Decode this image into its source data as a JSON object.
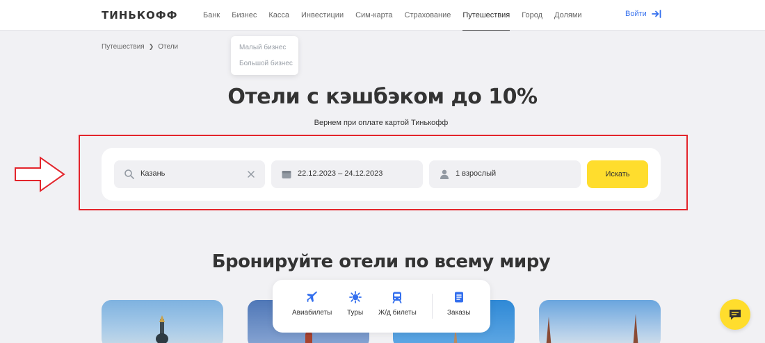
{
  "header": {
    "logo": "ТИНЬКОФФ",
    "nav": [
      {
        "label": "Банк"
      },
      {
        "label": "Бизнес"
      },
      {
        "label": "Касса"
      },
      {
        "label": "Инвестиции"
      },
      {
        "label": "Сим-карта"
      },
      {
        "label": "Страхование"
      },
      {
        "label": "Путешествия",
        "active": true
      },
      {
        "label": "Город"
      },
      {
        "label": "Долями"
      }
    ],
    "login_label": "Войти"
  },
  "dropdown": {
    "items": [
      "Малый бизнес",
      "Большой бизнес"
    ]
  },
  "breadcrumb": {
    "items": [
      "Путешествия",
      "Отели"
    ]
  },
  "hero": {
    "title": "Отели с кэшбэком до 10%",
    "subtitle": "Вернем при оплате картой Тинькофф"
  },
  "search": {
    "destination": "Казань",
    "dates": "22.12.2023 – 24.12.2023",
    "guests": "1 взрослый",
    "submit_label": "Искать"
  },
  "section": {
    "title": "Бронируйте отели по всему миру"
  },
  "tabs": [
    {
      "label": "Авиабилеты",
      "icon": "plane-icon"
    },
    {
      "label": "Туры",
      "icon": "tours-icon"
    },
    {
      "label": "Ж/д билеты",
      "icon": "train-icon"
    },
    {
      "label": "Заказы",
      "icon": "orders-icon"
    }
  ],
  "colors": {
    "accent_yellow": "#ffdd2d",
    "link_blue": "#336fee",
    "annotation_red": "#e3242b",
    "tab_icon_blue": "#336fee"
  }
}
